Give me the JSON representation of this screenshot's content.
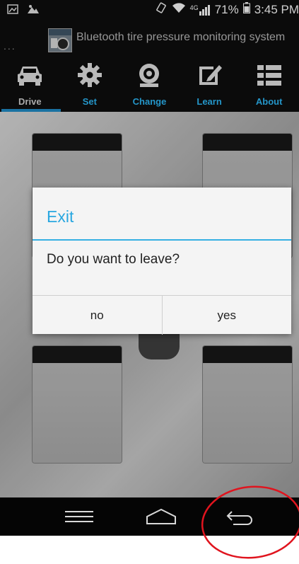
{
  "status_bar": {
    "network": "4G",
    "battery": "71%",
    "time": "3:45 PM"
  },
  "app": {
    "title": "Bluetooth tire pressure monitoring system",
    "overflow": "..."
  },
  "tabs": [
    {
      "label": "Drive",
      "icon": "car-icon",
      "active": true
    },
    {
      "label": "Set",
      "icon": "gear-icon",
      "active": false
    },
    {
      "label": "Change",
      "icon": "tire-icon",
      "active": false
    },
    {
      "label": "Learn",
      "icon": "edit-icon",
      "active": false
    },
    {
      "label": "About",
      "icon": "list-icon",
      "active": false
    }
  ],
  "dialog": {
    "title": "Exit",
    "message": "Do you want to leave?",
    "no_label": "no",
    "yes_label": "yes"
  },
  "nav_bar": {
    "menu": "menu-icon",
    "home": "home-icon",
    "back": "back-icon"
  },
  "colors": {
    "accent": "#29a7e0",
    "annotation": "#e0141e"
  }
}
